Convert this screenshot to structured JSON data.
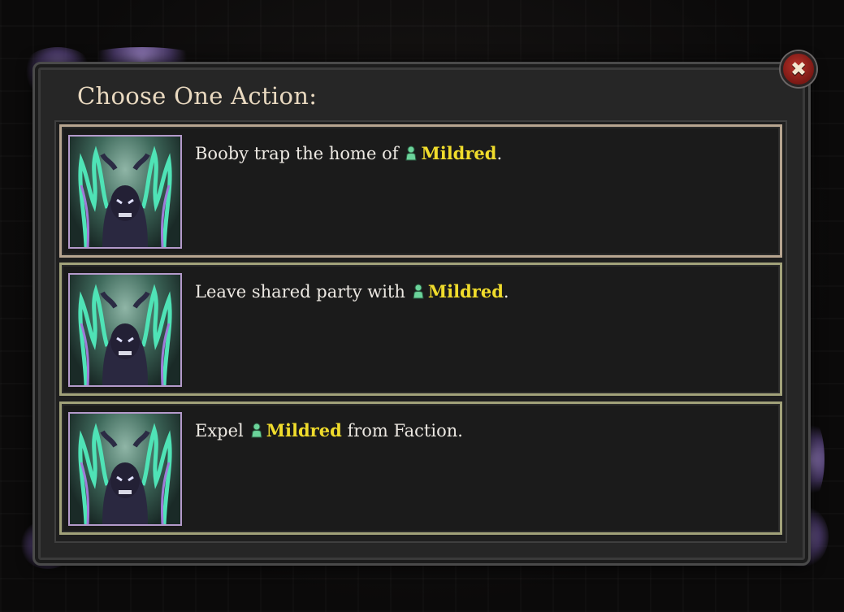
{
  "dialog": {
    "title": "Choose One Action:",
    "close_icon": "close-x-icon",
    "colors": {
      "name_highlight": "#f0dc2c",
      "close_button": "#a52a22",
      "portrait_frame": "#b49acb"
    }
  },
  "actions": [
    {
      "icon": "demon-portrait-icon",
      "prefix": "Booby trap the home of",
      "person_icon": "person-icon",
      "name": "Mildred",
      "suffix": "."
    },
    {
      "icon": "demon-portrait-icon",
      "prefix": "Leave shared party with",
      "person_icon": "person-icon",
      "name": "Mildred",
      "suffix": "."
    },
    {
      "icon": "demon-portrait-icon",
      "prefix": "Expel",
      "person_icon": "person-icon",
      "name": "Mildred",
      "suffix": " from Faction."
    }
  ]
}
